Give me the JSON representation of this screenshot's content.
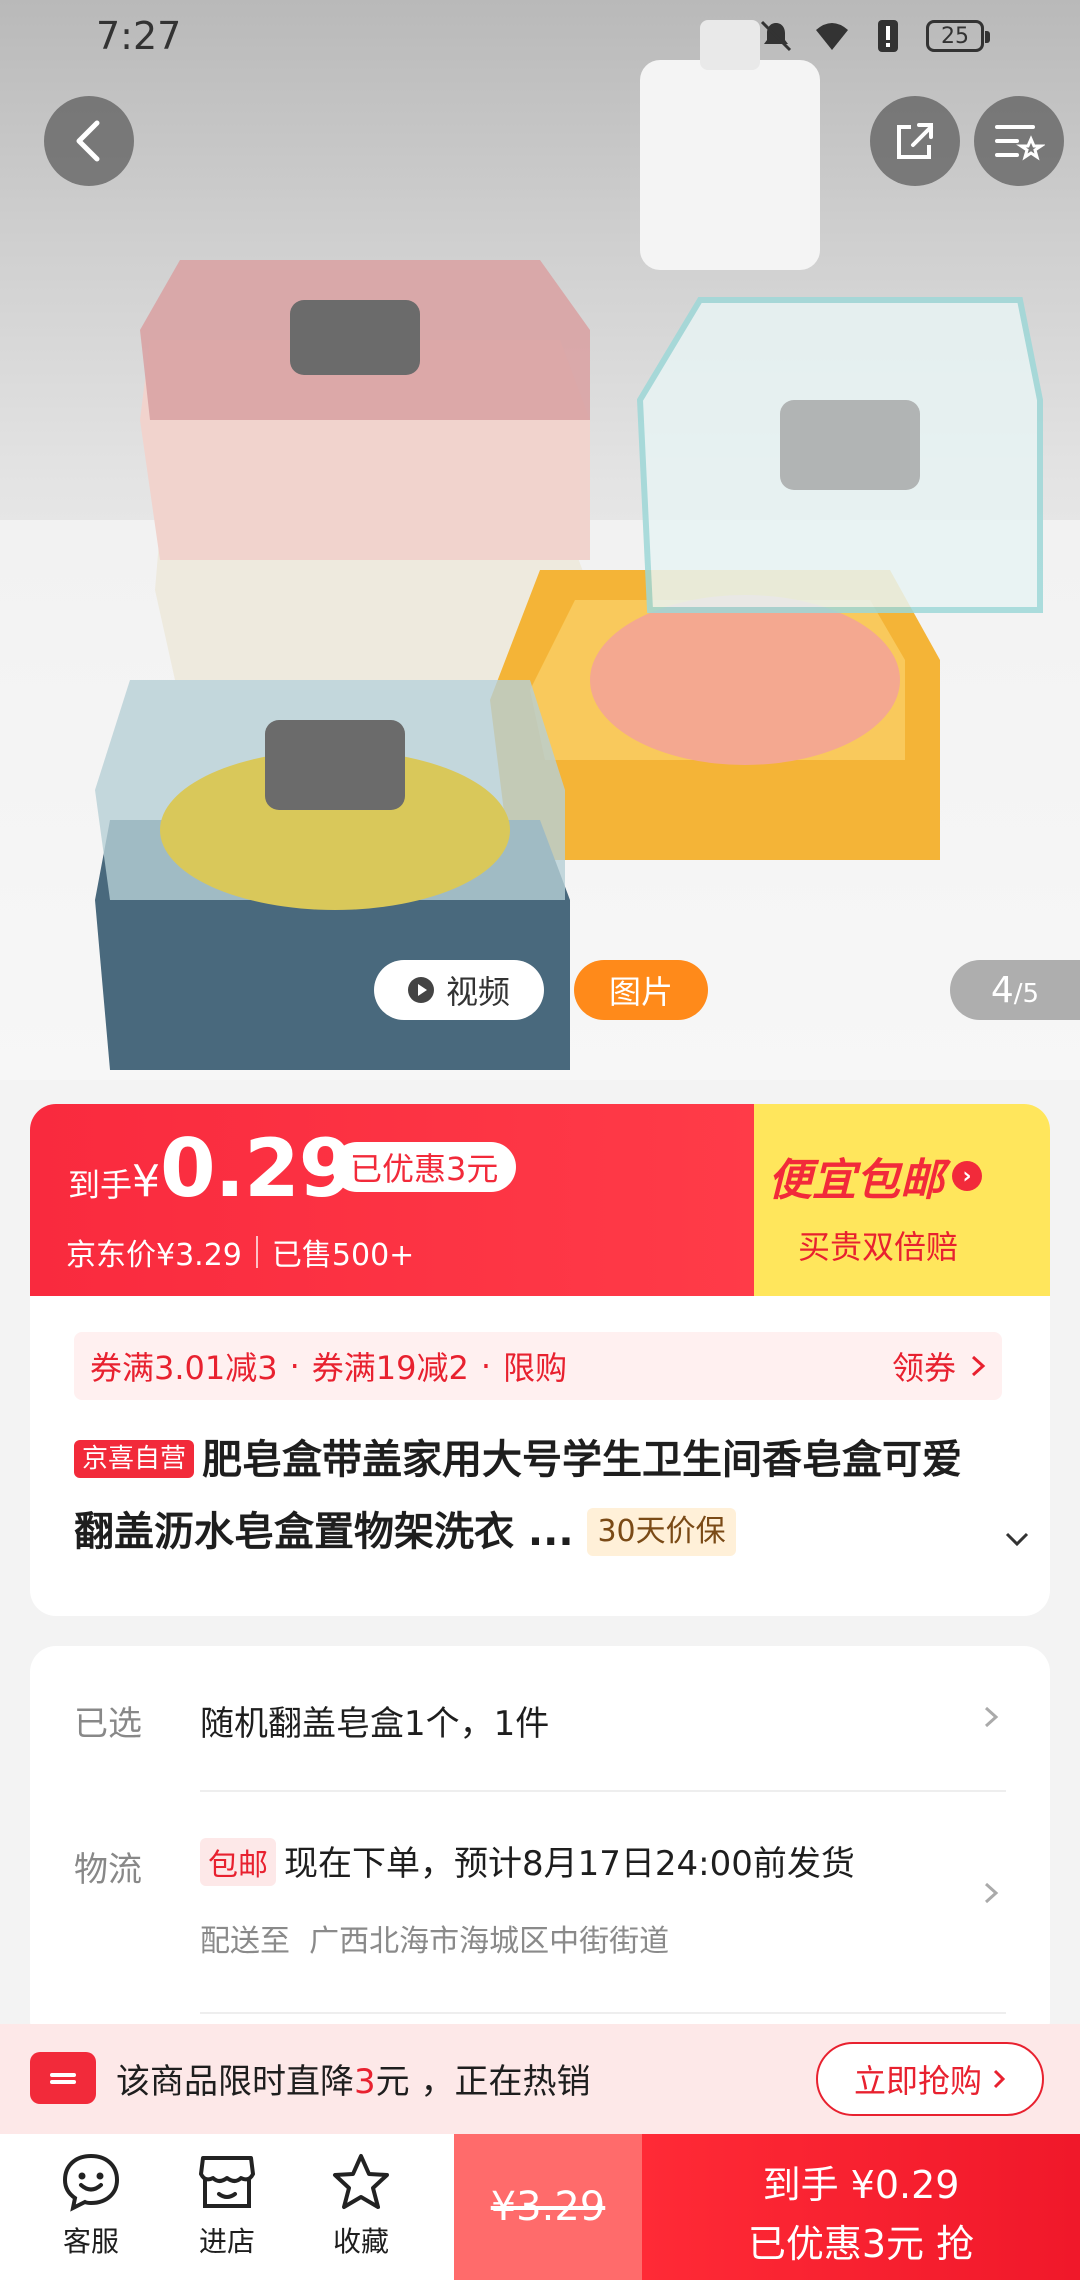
{
  "status_bar": {
    "time": "7:27",
    "battery": "25"
  },
  "media": {
    "video_label": "视频",
    "photo_label": "图片",
    "page_current": "4",
    "page_total": "/5"
  },
  "price": {
    "prefix": "到手",
    "currency": "¥",
    "value": "0.29",
    "discount_badge": "已优惠3元",
    "jd_price": "京东价¥3.29",
    "sold": "已售500+"
  },
  "promo": {
    "title": "便宜包邮",
    "subtitle": "买贵双倍赔"
  },
  "coupons": {
    "items": [
      "券满3.01减3",
      "券满19减2",
      "限购"
    ],
    "separator": "·",
    "get_label": "领券"
  },
  "product": {
    "self_tag": "京喜自营",
    "title": "肥皂盒带盖家用大号学生卫生间香皂盒可爱翻盖沥水皂盒置物架洗衣 ...",
    "guarantee_tag": "30天价保"
  },
  "options": {
    "selected_label": "已选",
    "selected_value": "随机翻盖皂盒1个，1件",
    "shipping_label": "物流",
    "free_shipping_tag": "包邮",
    "shipping_value": "现在下单，预计8月17日24:00前发货",
    "deliver_to": "配送至",
    "address": "广西北海市海城区中街街道"
  },
  "notice": {
    "text_before": "该商品限时直降",
    "highlight": "3",
    "text_after": "元 ，正在热销",
    "button": "立即抢购"
  },
  "bottom_bar": {
    "service": "客服",
    "store": "进店",
    "favorite": "收藏",
    "original_price": "¥3.29",
    "buy_line1": "到手 ¥0.29",
    "buy_line2": "已优惠3元 抢"
  },
  "colors": {
    "accent_red": "#f22a3a",
    "promo_yellow": "#ffe65c",
    "photo_orange": "#ff8a1a"
  }
}
